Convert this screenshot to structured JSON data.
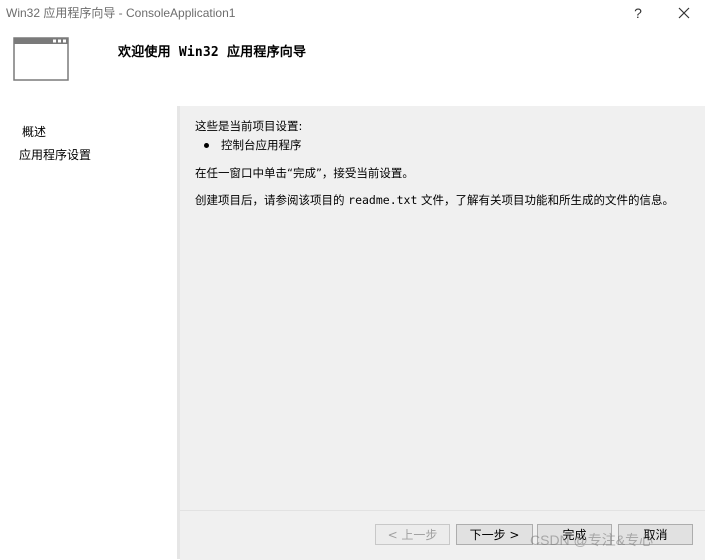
{
  "window": {
    "title": "Win32 应用程序向导 - ConsoleApplication1",
    "help_label": "?"
  },
  "header": {
    "title": "欢迎使用 Win32 应用程序向导"
  },
  "sidebar": {
    "items": [
      {
        "label": "概述"
      },
      {
        "label": "应用程序设置"
      }
    ]
  },
  "main": {
    "current_settings_label": "这些是当前项目设置:",
    "settings_bullets": [
      "控制台应用程序"
    ],
    "instruction": "在任一窗口中单击“完成”，接受当前设置。",
    "readme_prefix": "创建项目后，请参阅该项目的 ",
    "readme_file": "readme.txt",
    "readme_suffix": " 文件，了解有关项目功能和所生成的文件的信息。"
  },
  "footer": {
    "prev_label": "< 上一步",
    "next_label": "下一步 >",
    "finish_label": "完成",
    "cancel_label": "取消"
  },
  "watermark": "CSDN @专注&专心",
  "colors": {
    "panel_bg": "#f0f0f0",
    "title_text": "#6d6d6d"
  }
}
